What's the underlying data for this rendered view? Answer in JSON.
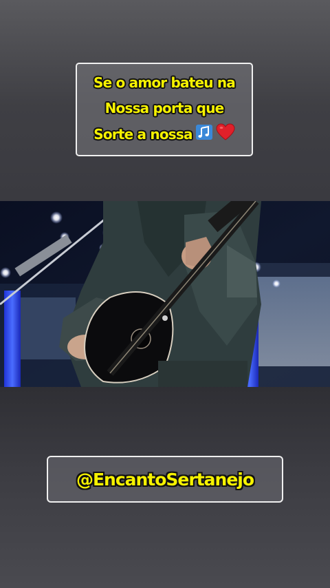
{
  "caption": {
    "lines": [
      "Se o amor bateu na",
      "Nossa porta que",
      "Sorte a nossa"
    ],
    "emojis": [
      "music-notes-icon",
      "red-heart-icon"
    ],
    "text_color": "#f6f200"
  },
  "video": {
    "scene": "video-frame"
  },
  "handle": {
    "text": "@EncantoSertanejo"
  }
}
